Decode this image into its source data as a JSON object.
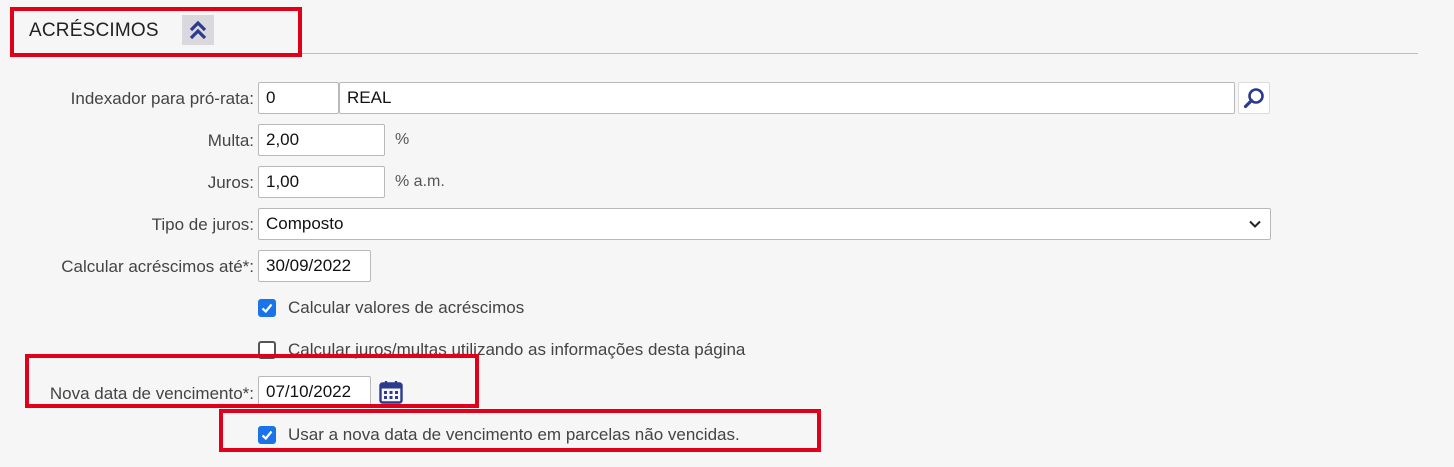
{
  "section": {
    "title": "ACRÉSCIMOS",
    "collapse_icon": "double-chevron-up-icon"
  },
  "form": {
    "indexador": {
      "label": "Indexador para pró-rata:",
      "code": "0",
      "name": "REAL",
      "search_icon": "search-icon"
    },
    "multa": {
      "label": "Multa:",
      "value": "2,00",
      "suffix": "%"
    },
    "juros": {
      "label": "Juros:",
      "value": "1,00",
      "suffix": "% a.m."
    },
    "tipo_juros": {
      "label": "Tipo de juros:",
      "selected": "Composto"
    },
    "calcular_ate": {
      "label": "Calcular acréscimos até*:",
      "value": "30/09/2022"
    },
    "chk_calcular_valores": {
      "label": "Calcular valores de acréscimos",
      "checked": true
    },
    "chk_calcular_juros": {
      "label": "Calcular juros/multas utilizando as informações desta página",
      "checked": false
    },
    "nova_data": {
      "label": "Nova data de vencimento*:",
      "value": "07/10/2022",
      "calendar_icon": "calendar-icon"
    },
    "chk_usar_nova_data": {
      "label": "Usar a nova data de vencimento em parcelas não vencidas.",
      "checked": true
    }
  },
  "colors": {
    "background": "#f6f6f6",
    "highlight": "#e1001a",
    "checkbox_checked": "#1a73e8",
    "icon_navy": "#2b3a8c"
  }
}
